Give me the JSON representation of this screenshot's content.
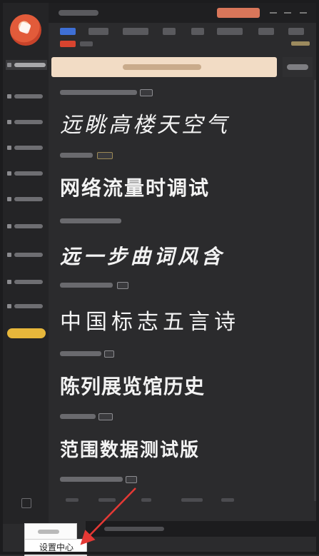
{
  "previews": [
    {
      "text": "远眺高楼天空气"
    },
    {
      "text": "网络流量时调试"
    },
    {
      "text": "远一步曲词风含"
    },
    {
      "text": "中国标志五言诗"
    },
    {
      "text": "陈列展览馆历史"
    },
    {
      "text": "范围数据测试版"
    }
  ],
  "context_menu": {
    "settings_label": "设置中心"
  },
  "colors": {
    "accent_blue": "#3e6fd6",
    "accent_red": "#d8442f",
    "badge_gold": "#e7b73b",
    "annotation_arrow": "#e53935",
    "banner_bg": "#f2dcc5"
  },
  "icons": [
    "app-logo-icon",
    "minimize-icon",
    "close-icon",
    "settings-menu-icon"
  ]
}
